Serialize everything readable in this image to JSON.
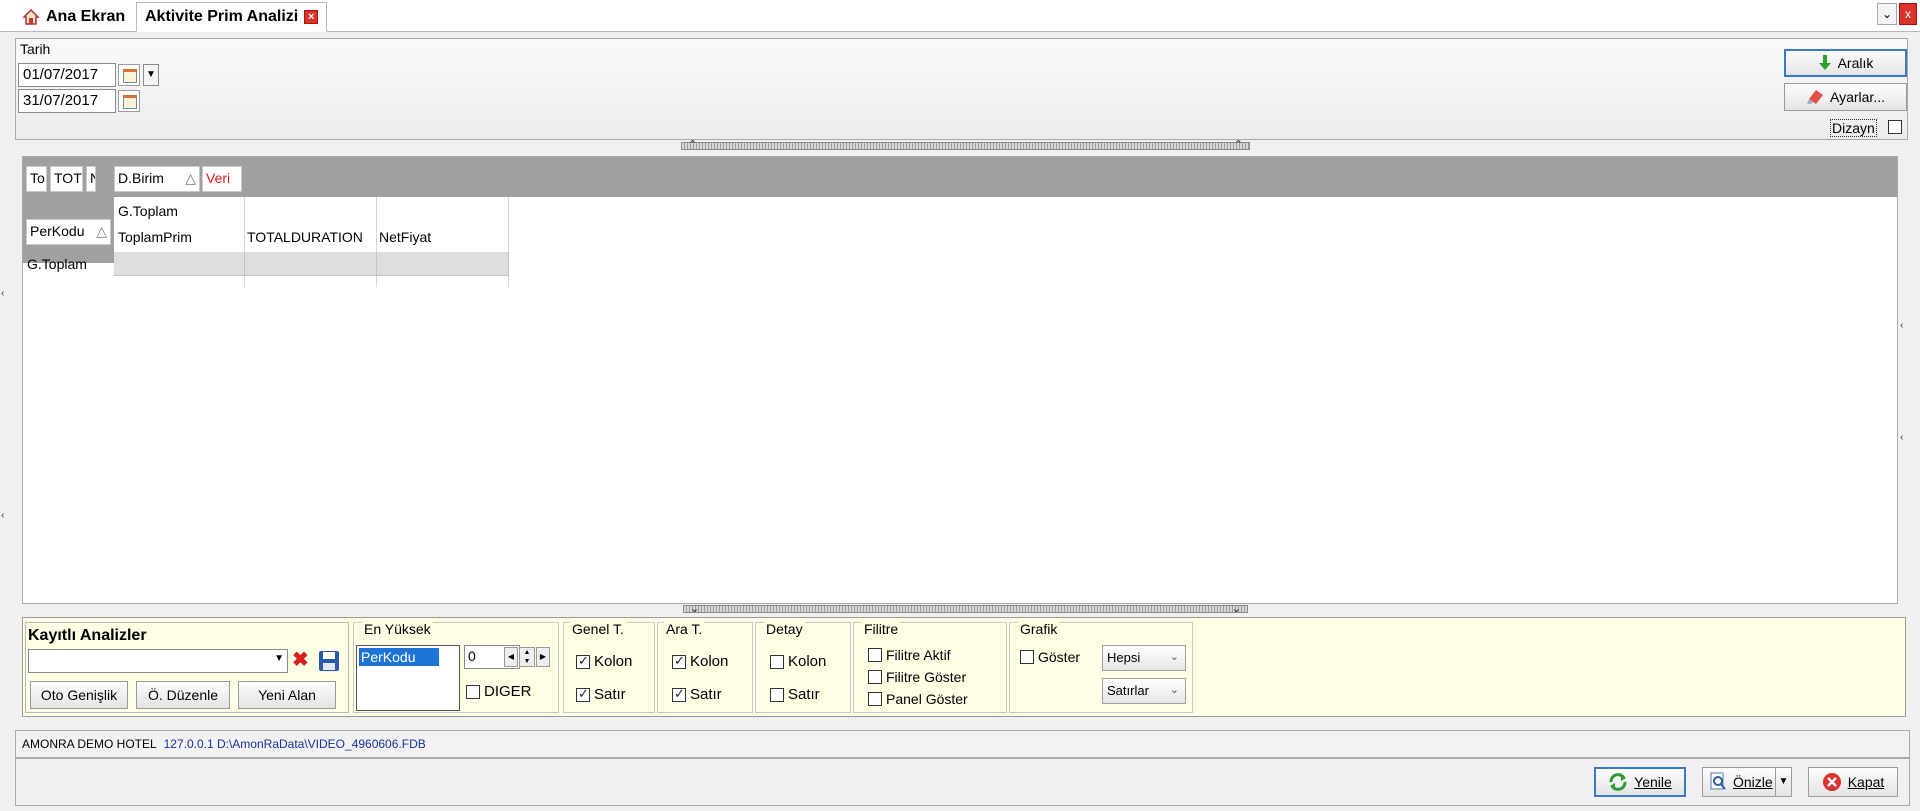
{
  "tabs": [
    {
      "label": "Ana Ekran",
      "icon": "home-icon"
    },
    {
      "label": "Aktivite Prim Analizi",
      "icon": "close-tab-icon"
    }
  ],
  "window_controls": {
    "dropdown": "⌄",
    "close": "x"
  },
  "header": {
    "tarih_label": "Tarih",
    "date_from": "01/07/2017",
    "date_to": "31/07/2017",
    "aralik_label": "Aralık",
    "ayarlar_label": "Ayarlar...",
    "dizayn_label": "Dizayn"
  },
  "pivot": {
    "filter_fields": [
      "To",
      "TOT",
      "N",
      "D.Birim",
      "Veri"
    ],
    "sort_glyph": "△",
    "row_field": "PerKodu",
    "column_header": "G.Toplam",
    "data_fields": [
      "ToplamPrim",
      "TOTALDURATION",
      "NetFiyat"
    ],
    "row_total_label": "G.Toplam",
    "veri_color": "#e0201c"
  },
  "options": {
    "kayitli_title": "Kayıtlı Analizler",
    "oto_genislik": "Oto Genişlik",
    "o_duzenle": "Ö. Düzenle",
    "yeni_alan": "Yeni Alan",
    "en_yuksek_title": "En Yüksek",
    "en_yuksek_item": "PerKodu",
    "en_yuksek_value": "0",
    "diger_label": "DIGER",
    "genel_t_title": "Genel T.",
    "ara_t_title": "Ara T.",
    "detay_title": "Detay",
    "kolon": "Kolon",
    "satir": "Satır",
    "filitre_title": "Filitre",
    "filitre_aktif": "Filitre Aktif",
    "filitre_goster": "Filitre Göster",
    "panel_goster": "Panel Göster",
    "grafik_title": "Grafik",
    "goster": "Göster",
    "hepsi": "Hepsi",
    "satirlar": "Satırlar",
    "checks": {
      "genel_kolon": true,
      "genel_satir": true,
      "ara_kolon": true,
      "ara_satir": true,
      "detay_kolon": false,
      "detay_satir": false,
      "filitre_aktif": false,
      "filitre_goster": false,
      "panel_goster": false,
      "grafik_goster": false,
      "diger": false,
      "dizayn": false
    }
  },
  "status": {
    "hotel": "AMONRA DEMO HOTEL",
    "connection": "127.0.0.1 D:\\AmonRaData\\VIDEO_4960606.FDB",
    "connection_color": "#1a2fa0"
  },
  "footer": {
    "yenile": "Yenile",
    "onizle": "Önizle",
    "kapat": "Kapat"
  }
}
